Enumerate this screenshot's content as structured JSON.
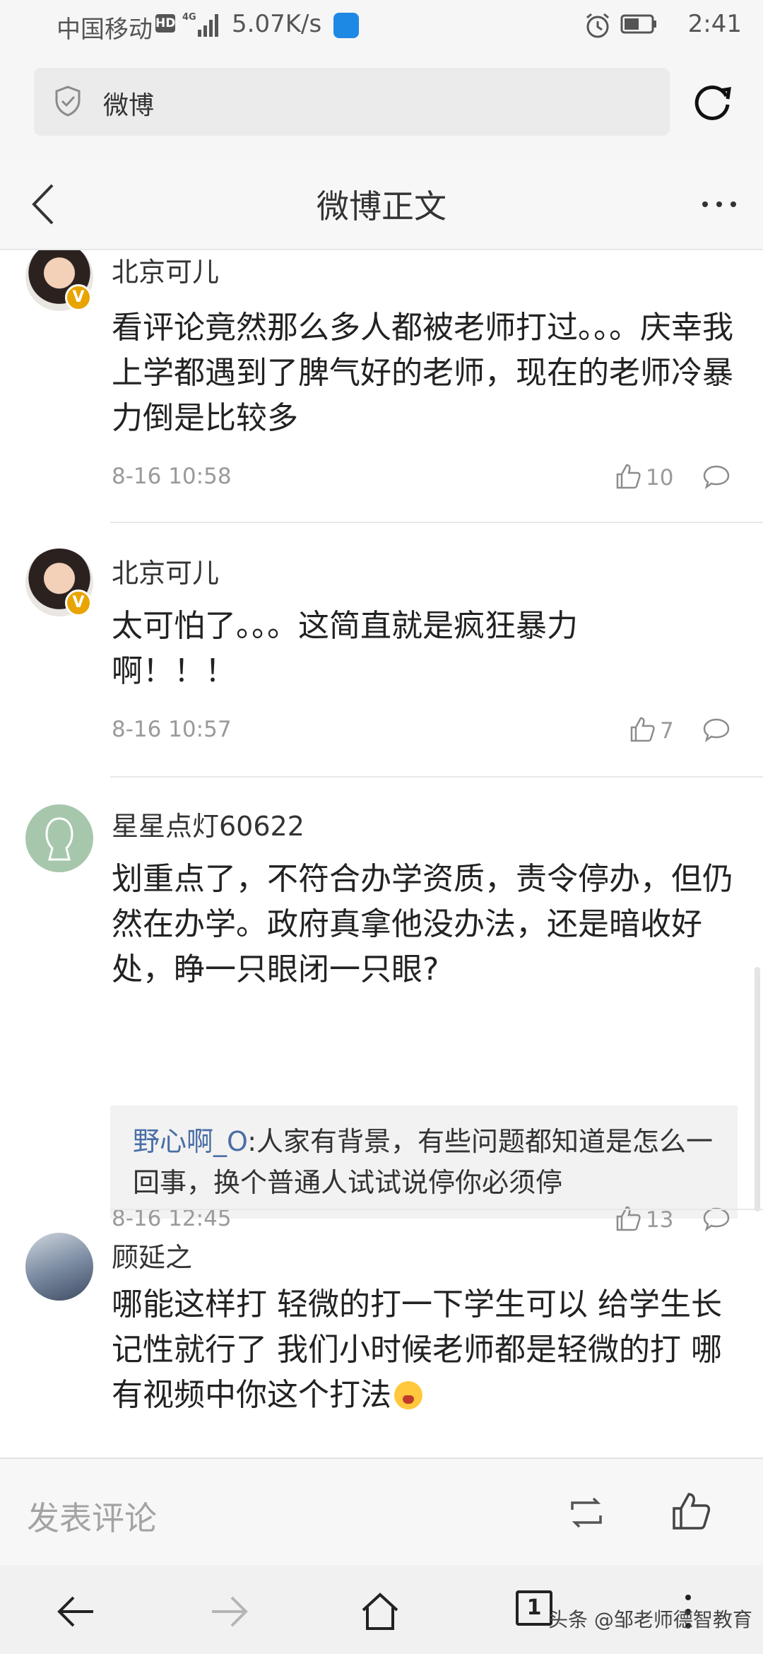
{
  "status_bar": {
    "carrier": "中国移动",
    "hd_label": "HD",
    "net_label": "4G",
    "speed": "5.07K/s",
    "time": "2:41"
  },
  "browser": {
    "url_text": "微博"
  },
  "nav": {
    "title": "微博正文"
  },
  "comments": [
    {
      "user": "北京可儿",
      "verified": "V",
      "text": "看评论竟然那么多人都被老师打过。。。庆幸我上学都遇到了脾气好的老师，现在的老师冷暴力倒是比较多",
      "time": "8-16 10:58",
      "likes": "10"
    },
    {
      "user": "北京可儿",
      "verified": "V",
      "text": "太可怕了。。。这简直就是疯狂暴力啊！！！",
      "time": "8-16 10:57",
      "likes": "7"
    },
    {
      "user": "星星点灯60622",
      "text": "划重点了，不符合办学资质，责令停办，但仍然在办学。政府真拿他没办法，还是暗收好处，睁一只眼闭一只眼?",
      "reply_user": "野心啊_O",
      "reply_text": ":人家有背景，有些问题都知道是怎么一回事，换个普通人试试说停你必须停",
      "time": "8-16 12:45",
      "likes": "13"
    },
    {
      "user": "顾延之",
      "text": "哪能这样打 轻微的打一下学生可以 给学生长记性就行了 我们小时候老师都是轻微的打 哪有视频中你这个打法"
    }
  ],
  "composer": {
    "placeholder": "发表评论"
  },
  "bottom_nav": {
    "tab_count": "1",
    "watermark": "头条 @邹老师德智教育"
  },
  "colors": {
    "link_blue": "#4a6ea6",
    "verified_badge": "#e8a400",
    "meta_gray": "#9a9a9a"
  }
}
